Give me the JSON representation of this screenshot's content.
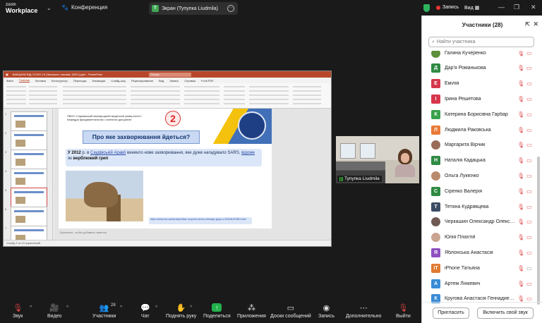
{
  "app": {
    "logo_line1": "zoom",
    "logo_line2": "Workplace",
    "conference_label": "Конференция",
    "screen_share_label": "Экран (Тупупка Liudmila)",
    "screen_share_initial": "Т",
    "record_label": "Запись",
    "view_label": "Вид"
  },
  "presentation": {
    "window_title": "ВАКЦИНИ ВІД COVID-19 (Загальна і вікова): [2021].pptx - PowerPoint",
    "search_placeholder": "Пошук",
    "tabs": [
      "Файл",
      "Главная",
      "Вставка",
      "Конструктор",
      "Переходы",
      "Анимация",
      "Слайд-шоу",
      "Рецензирование",
      "Вид",
      "Запись",
      "Справка",
      "Foxit PDF"
    ],
    "active_tab": "Главная",
    "slide_numbers": [
      "1",
      "2",
      "3",
      "4",
      "5",
      "6",
      "7"
    ],
    "university": "ПВНЗ «Харківський міжнародний медичний університет»",
    "department": "Кафедра фундаментальних і клінічних дисциплін",
    "slide_number_badge": "2",
    "question": "Про яке захворювання йдеться?",
    "text_lead": "У 2012",
    "text_mid": "р. в ",
    "text_place": "Саудівській Аравії",
    "text_rest": " виникло нове захворювання, яке дуже нагадувало SARS, ",
    "text_known": "відоме",
    "text_as": " як ",
    "text_bold_end": "верблюжий грип",
    "link": "https://www.rbc.ua/ukr/styler/lkar-rozpoviv-shcho-chekaye-gripu-u-2020/6197681.html",
    "notes_placeholder": "Щелкните, чтобы добавить заметки",
    "status": "Слайд 2 из 24     украинский"
  },
  "video_tile": {
    "name": "Тупупка Liudmila"
  },
  "toolbar": {
    "mute": "Звук",
    "video": "Видео",
    "participants": "Участники",
    "participants_count": "28",
    "chat": "Чат",
    "raise_hand": "Поднять руку",
    "share": "Поделиться",
    "apps": "Приложения",
    "whiteboards": "Доски сообщений",
    "record": "Запись",
    "more": "Дополнительно",
    "leave": "Выйти"
  },
  "participants": {
    "title": "Участники (28)",
    "search_placeholder": "Найти участника",
    "list": [
      {
        "initial": "",
        "name": "Галина Кучеренко",
        "color": "#5e8f3b"
      },
      {
        "initial": "Д",
        "name": "Дар'я Романькова",
        "color": "#2f8a43"
      },
      {
        "initial": "Е",
        "name": "Емілія",
        "color": "#d6364c"
      },
      {
        "initial": "І",
        "name": "Ірина Решетова",
        "color": "#d6364c"
      },
      {
        "initial": "К",
        "name": "Катерина Борисівна Гарбар",
        "color": "#3aa14b"
      },
      {
        "initial": "Л",
        "name": "Людмила Раковська",
        "color": "#e87a36"
      },
      {
        "initial": "",
        "name": "Маргарита Вірчик",
        "color": "#9a6b57"
      },
      {
        "initial": "Н",
        "name": "Наталія Кадацька",
        "color": "#2f8a43"
      },
      {
        "initial": "",
        "name": "Ольга Лукієнко",
        "color": "#b98a6e"
      },
      {
        "initial": "С",
        "name": "Сіренко Валерія",
        "color": "#2f8a43"
      },
      {
        "initial": "Т",
        "name": "Тетяна Кудрявцева",
        "color": "#3b4c63"
      },
      {
        "initial": "",
        "name": "Черкашин Олександр Олекса...",
        "color": "#6f5a52"
      },
      {
        "initial": "",
        "name": "Юлія Плахтій",
        "color": "#c9a490"
      },
      {
        "initial": "Я",
        "name": "Яблонська Анастасія",
        "color": "#8e4fbf"
      },
      {
        "initial": "iT",
        "name": "iPhone Татьяна",
        "color": "#e07a32"
      },
      {
        "initial": "А",
        "name": "Артем Лінкевич",
        "color": "#3a8bd6"
      },
      {
        "initial": "К",
        "name": "Кругова Анастасія Геннадиевна",
        "color": "#3a8bd6"
      }
    ],
    "invite": "Пригласить",
    "unmute_me": "Включить свой звук"
  }
}
